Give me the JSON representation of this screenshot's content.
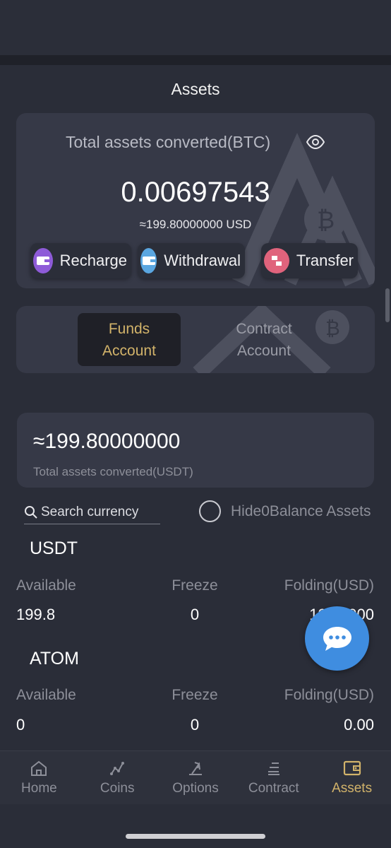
{
  "header": {
    "title": "Assets"
  },
  "summary": {
    "label": "Total assets converted(BTC)",
    "btc_value": "0.00697543",
    "usd_approx": "≈199.80000000 USD",
    "actions": [
      {
        "label": "Recharge",
        "icon": "wallet-icon",
        "color": "#8e5bd8"
      },
      {
        "label": "Withdrawal",
        "icon": "wallet-icon",
        "color": "#5aa6e0"
      },
      {
        "label": "Transfer",
        "icon": "transfer-icon",
        "color": "#e0637c"
      }
    ]
  },
  "account_tabs": {
    "funds": {
      "line1": "Funds",
      "line2": "Account",
      "active": true
    },
    "contract": {
      "line1": "Contract",
      "line2": "Account",
      "active": false
    }
  },
  "usdt_total": {
    "value": "≈199.80000000",
    "label": "Total assets converted(USDT)"
  },
  "filters": {
    "search_placeholder": "Search currency",
    "hide_zero_label": "Hide0Balance Assets"
  },
  "columns": {
    "available": "Available",
    "freeze": "Freeze",
    "folding": "Folding(USD)"
  },
  "coins": [
    {
      "name": "USDT",
      "available": "199.8",
      "freeze": "0",
      "folding": "199.8000"
    },
    {
      "name": "ATOM",
      "available": "0",
      "freeze": "0",
      "folding": "0.00"
    }
  ],
  "nav": [
    {
      "label": "Home",
      "icon": "home-icon",
      "active": false
    },
    {
      "label": "Coins",
      "icon": "chart-icon",
      "active": false
    },
    {
      "label": "Options",
      "icon": "options-icon",
      "active": false
    },
    {
      "label": "Contract",
      "icon": "contract-icon",
      "active": false
    },
    {
      "label": "Assets",
      "icon": "wallet-icon",
      "active": true
    }
  ],
  "colors": {
    "accent": "#d2b36a",
    "background": "#2a2d38",
    "card": "#363947",
    "fab": "#3f8de0"
  }
}
